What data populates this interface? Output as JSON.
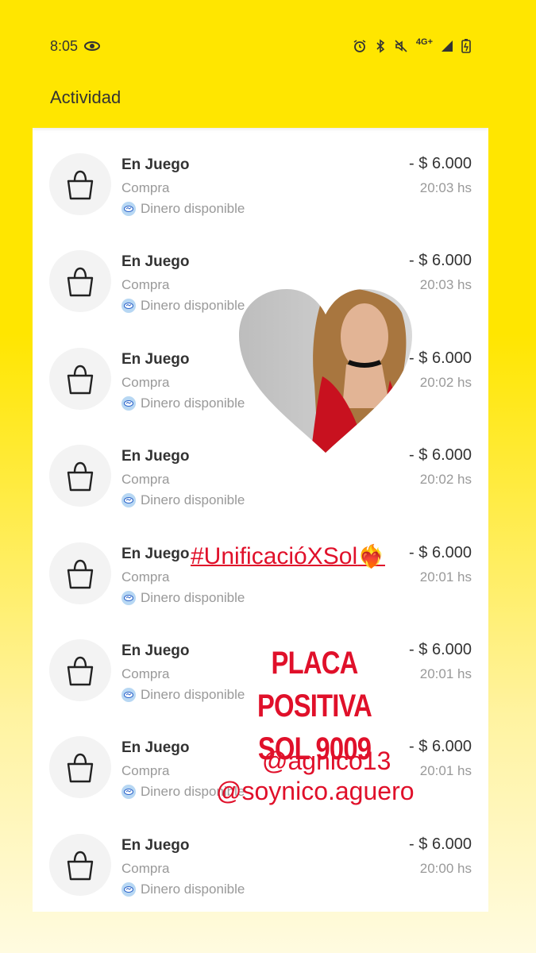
{
  "status_bar": {
    "time": "8:05",
    "network": "4G+"
  },
  "header": {
    "title": "Actividad"
  },
  "activity": [
    {
      "name": "En Juego",
      "type": "Compra",
      "source": "Dinero disponible",
      "amount": "- $ 6.000",
      "time": "20:03 hs"
    },
    {
      "name": "En Juego",
      "type": "Compra",
      "source": "Dinero disponible",
      "amount": "- $ 6.000",
      "time": "20:03 hs"
    },
    {
      "name": "En Juego",
      "type": "Compra",
      "source": "Dinero disponible",
      "amount": "- $ 6.000",
      "time": "20:02 hs"
    },
    {
      "name": "En Juego",
      "type": "Compra",
      "source": "Dinero disponible",
      "amount": "- $ 6.000",
      "time": "20:02 hs"
    },
    {
      "name": "En Juego",
      "type": "Compra",
      "source": "Dinero disponible",
      "amount": "- $ 6.000",
      "time": "20:01 hs"
    },
    {
      "name": "En Juego",
      "type": "Compra",
      "source": "Dinero disponible",
      "amount": "- $ 6.000",
      "time": "20:01 hs"
    },
    {
      "name": "En Juego",
      "type": "Compra",
      "source": "Dinero disponible",
      "amount": "- $ 6.000",
      "time": "20:01 hs"
    },
    {
      "name": "En Juego",
      "type": "Compra",
      "source": "Dinero disponible",
      "amount": "- $ 6.000",
      "time": "20:00 hs"
    }
  ],
  "overlay": {
    "hashtag": "#UnificacióXSol",
    "placa_line1": "PLACA POSITIVA",
    "placa_line2": "SOL 9009",
    "handle1": "@agnico13",
    "handle2": "@soynico.aguero"
  },
  "colors": {
    "brand_yellow": "#ffe600",
    "overlay_red": "#e0102a"
  }
}
